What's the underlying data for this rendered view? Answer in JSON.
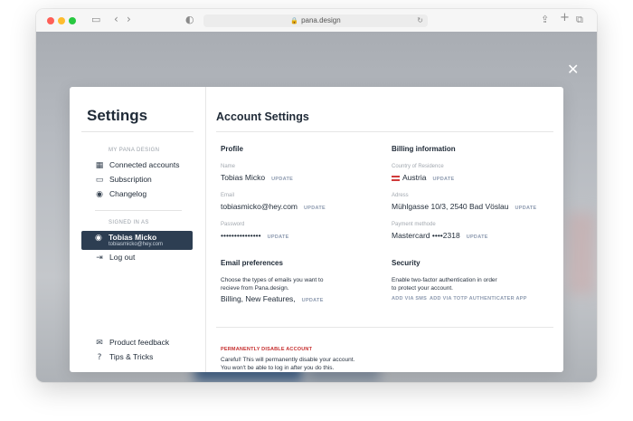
{
  "browser": {
    "url": "pana.design",
    "traffic_colors": {
      "close": "#fe5f57",
      "minimize": "#febc2e",
      "maximize": "#28c840"
    }
  },
  "modal": {
    "sidebar": {
      "title": "Settings",
      "section_design": "MY PANA DESIGN",
      "items": [
        {
          "label": "Connected accounts",
          "icon": "grid-icon"
        },
        {
          "label": "Subscription",
          "icon": "card-icon"
        },
        {
          "label": "Changelog",
          "icon": "user-circle-icon"
        }
      ],
      "section_signed": "SIGNED IN AS",
      "user": {
        "name": "Tobias Micko",
        "email": "tobiasmicko@hey.com"
      },
      "logout": "Log out",
      "footer": [
        {
          "label": "Product feedback",
          "icon": "mail-icon"
        },
        {
          "label": "Tips & Tricks",
          "icon": "help-icon"
        }
      ]
    },
    "content": {
      "title": "Account Settings",
      "profile": {
        "heading": "Profile",
        "name_label": "Name",
        "name_value": "Tobias Micko",
        "email_label": "Email",
        "email_value": "tobiasmicko@hey.com",
        "password_label": "Password",
        "password_value": "•••••••••••••••"
      },
      "update_label": "UPDATE",
      "billing": {
        "heading": "Billing information",
        "country_label": "Country of Residence",
        "country_value": "Austria",
        "address_label": "Adress",
        "address_value": "Mühlgasse 10/3, 2540 Bad Vöslau",
        "payment_label": "Payment methode",
        "payment_value": "Mastercard ••••2318"
      },
      "email_prefs": {
        "heading": "Email preferences",
        "description_1": "Choose the types of emails you want to",
        "description_2": "recieve from Pana.design.",
        "value": "Billing, New Features,"
      },
      "security": {
        "heading": "Security",
        "description_1": "Enable two-factor authentication in order",
        "description_2": "to protect your account.",
        "sms_link": "ADD VIA SMS",
        "totp_link": "ADD VIA TOTP AUTHENTICATER APP"
      },
      "danger": {
        "heading": "PERMANENTLY DISABLE ACCOUNT",
        "line_1": "Careful! This will permanently disable your account.",
        "line_2": "You won't be able to log in after you do this."
      }
    }
  }
}
